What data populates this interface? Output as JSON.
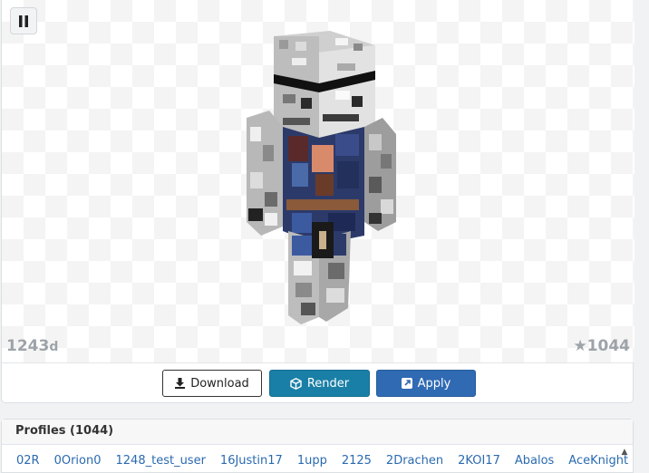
{
  "viewer": {
    "views_value": "1243",
    "views_unit": "d",
    "stars": "★1044"
  },
  "actions": {
    "download_label": "Download",
    "render_label": "Render",
    "apply_label": "Apply"
  },
  "profiles": {
    "header": "Profiles (1044)",
    "names": [
      "02R",
      "0Orion0",
      "1248_test_user",
      "16Justin17",
      "1upp",
      "2125",
      "2Drachen",
      "2KOI17",
      "Abalos",
      "AceKnight"
    ]
  }
}
